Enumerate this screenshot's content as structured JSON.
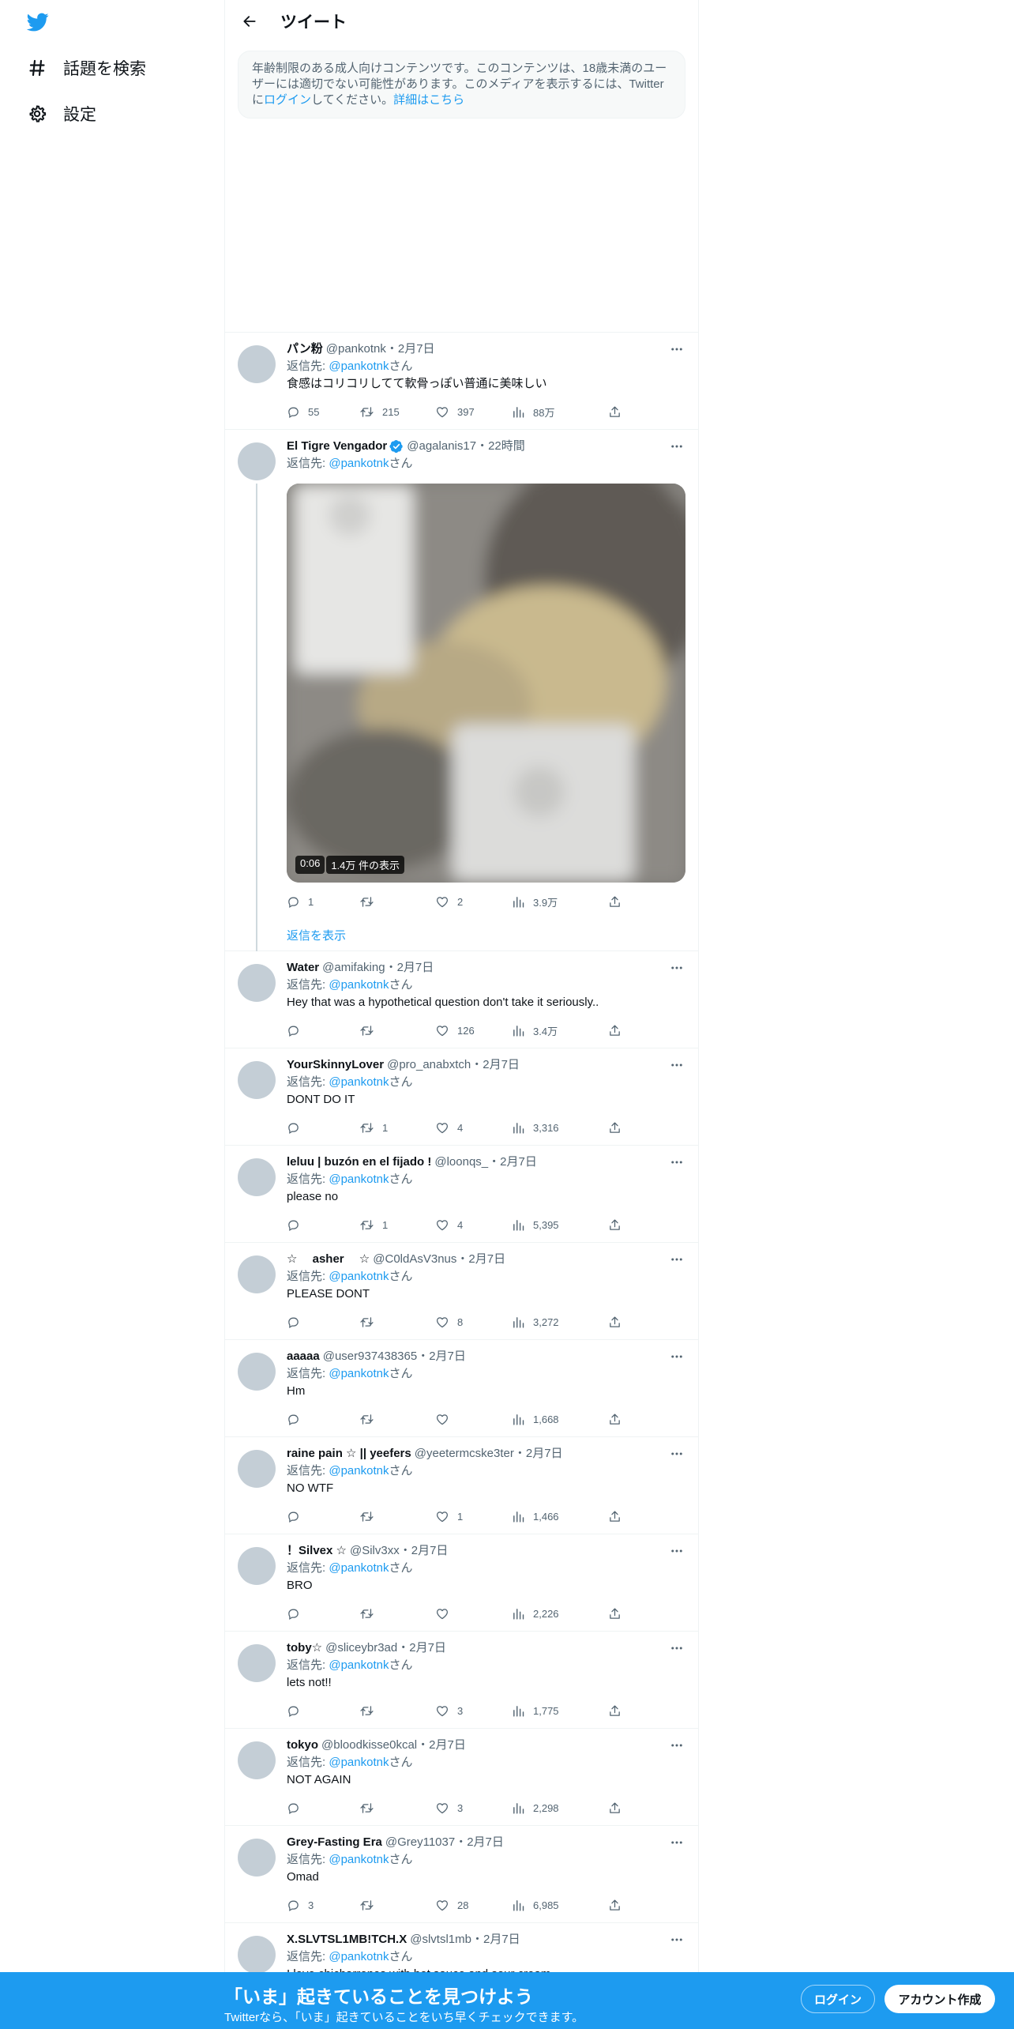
{
  "nav": {
    "explore_label": "話題を検索",
    "settings_label": "設定"
  },
  "header": {
    "title": "ツイート"
  },
  "notice": {
    "part1": "年齢制限のある成人向けコンテンツです。このコンテンツは、18歳未満のユーザーには適切でない可能性があります。このメディアを表示するには、Twitterに",
    "login_link": "ログイン",
    "part2": "してください。",
    "learn_more": "詳細はこちら"
  },
  "reply_prefix": "返信先: ",
  "reply_suffix": "さん",
  "tweets": [
    {
      "name": "パン粉",
      "handle": "@pankotnk",
      "date": "・2月7日",
      "reply_to": "@pankotnk",
      "text": "食感はコリコリしてて軟骨っぽい普通に美味しい",
      "replies": "55",
      "retweets": "215",
      "likes": "397",
      "views": "88万"
    },
    {
      "name": "El Tigre Vengador",
      "handle": "@agalanis17",
      "date": "・22時間",
      "reply_to": "@pankotnk",
      "text": "",
      "replies": "1",
      "retweets": "",
      "likes": "2",
      "views": "3.9万",
      "media_duration": "0:06",
      "media_views": "1.4万 件の表示",
      "show_replies": "返信を表示"
    },
    {
      "name": "Water",
      "handle": "@amifaking",
      "date": "・2月7日",
      "reply_to": "@pankotnk",
      "text": "Hey that was a hypothetical question don't take it seriously..",
      "replies": "",
      "retweets": "",
      "likes": "126",
      "views": "3.4万"
    },
    {
      "name": "YourSkinnyLover",
      "handle": "@pro_anabxtch",
      "date": "・2月7日",
      "reply_to": "@pankotnk",
      "text": "DONT DO IT",
      "replies": "",
      "retweets": "1",
      "likes": "4",
      "views": "3,316"
    },
    {
      "name": "leluu | buzón en el fijado !",
      "handle": "@loonqs_",
      "date": "・2月7日",
      "reply_to": "@pankotnk",
      "text": "please no",
      "replies": "",
      "retweets": "1",
      "likes": "4",
      "views": "5,395"
    },
    {
      "name": "☆　 asher　 ☆",
      "handle": "@C0ldAsV3nus",
      "date": "・2月7日",
      "reply_to": "@pankotnk",
      "text": "PLEASE DONT",
      "replies": "",
      "retweets": "",
      "likes": "8",
      "views": "3,272"
    },
    {
      "name": "aaaaa",
      "handle": "@user937438365",
      "date": "・2月7日",
      "reply_to": "@pankotnk",
      "text": "Hm",
      "replies": "",
      "retweets": "",
      "likes": "",
      "views": "1,668"
    },
    {
      "name": "raine pain ☆ || yeefers",
      "handle": "@yeetermcske3ter",
      "date": "・2月7日",
      "reply_to": "@pankotnk",
      "text": "NO WTF",
      "replies": "",
      "retweets": "",
      "likes": "1",
      "views": "1,466"
    },
    {
      "name": "！Silvex ☆",
      "handle": "@Silv3xx",
      "date": "・2月7日",
      "reply_to": "@pankotnk",
      "text": "BRO",
      "replies": "",
      "retweets": "",
      "likes": "",
      "views": "2,226"
    },
    {
      "name": "toby☆",
      "handle": "@sliceybr3ad",
      "date": "・2月7日",
      "reply_to": "@pankotnk",
      "text": "lets not!!",
      "replies": "",
      "retweets": "",
      "likes": "3",
      "views": "1,775"
    },
    {
      "name": "tokyo",
      "handle": "@bloodkisse0kcal",
      "date": "・2月7日",
      "reply_to": "@pankotnk",
      "text": "NOT AGAIN",
      "replies": "",
      "retweets": "",
      "likes": "3",
      "views": "2,298"
    },
    {
      "name": "Grey-Fasting Era",
      "handle": "@Grey11037",
      "date": "・2月7日",
      "reply_to": "@pankotnk",
      "text": "Omad",
      "replies": "3",
      "retweets": "",
      "likes": "28",
      "views": "6,985"
    },
    {
      "name": "X.SLVTSL1MB!TCH.X",
      "handle": "@slvtsl1mb",
      "date": "・2月7日",
      "reply_to": "@pankotnk",
      "text": "I love chicharrones with hot sauce and sour cream"
    }
  ],
  "bottombar": {
    "title": "「いま」起きていることを見つけよう",
    "subtitle": "Twitterなら、「いま」起きていることをいち早くチェックできます。",
    "login": "ログイン",
    "signup": "アカウント作成"
  },
  "colors": {
    "accent": "#1d9bf0",
    "text": "#0f1419",
    "muted": "#536471"
  },
  "icons": [
    "twitter-logo-icon",
    "hashtag-icon",
    "gear-icon",
    "back-arrow-icon",
    "more-icon",
    "reply-icon",
    "retweet-icon",
    "like-icon",
    "views-icon",
    "share-icon",
    "verified-badge-icon"
  ]
}
